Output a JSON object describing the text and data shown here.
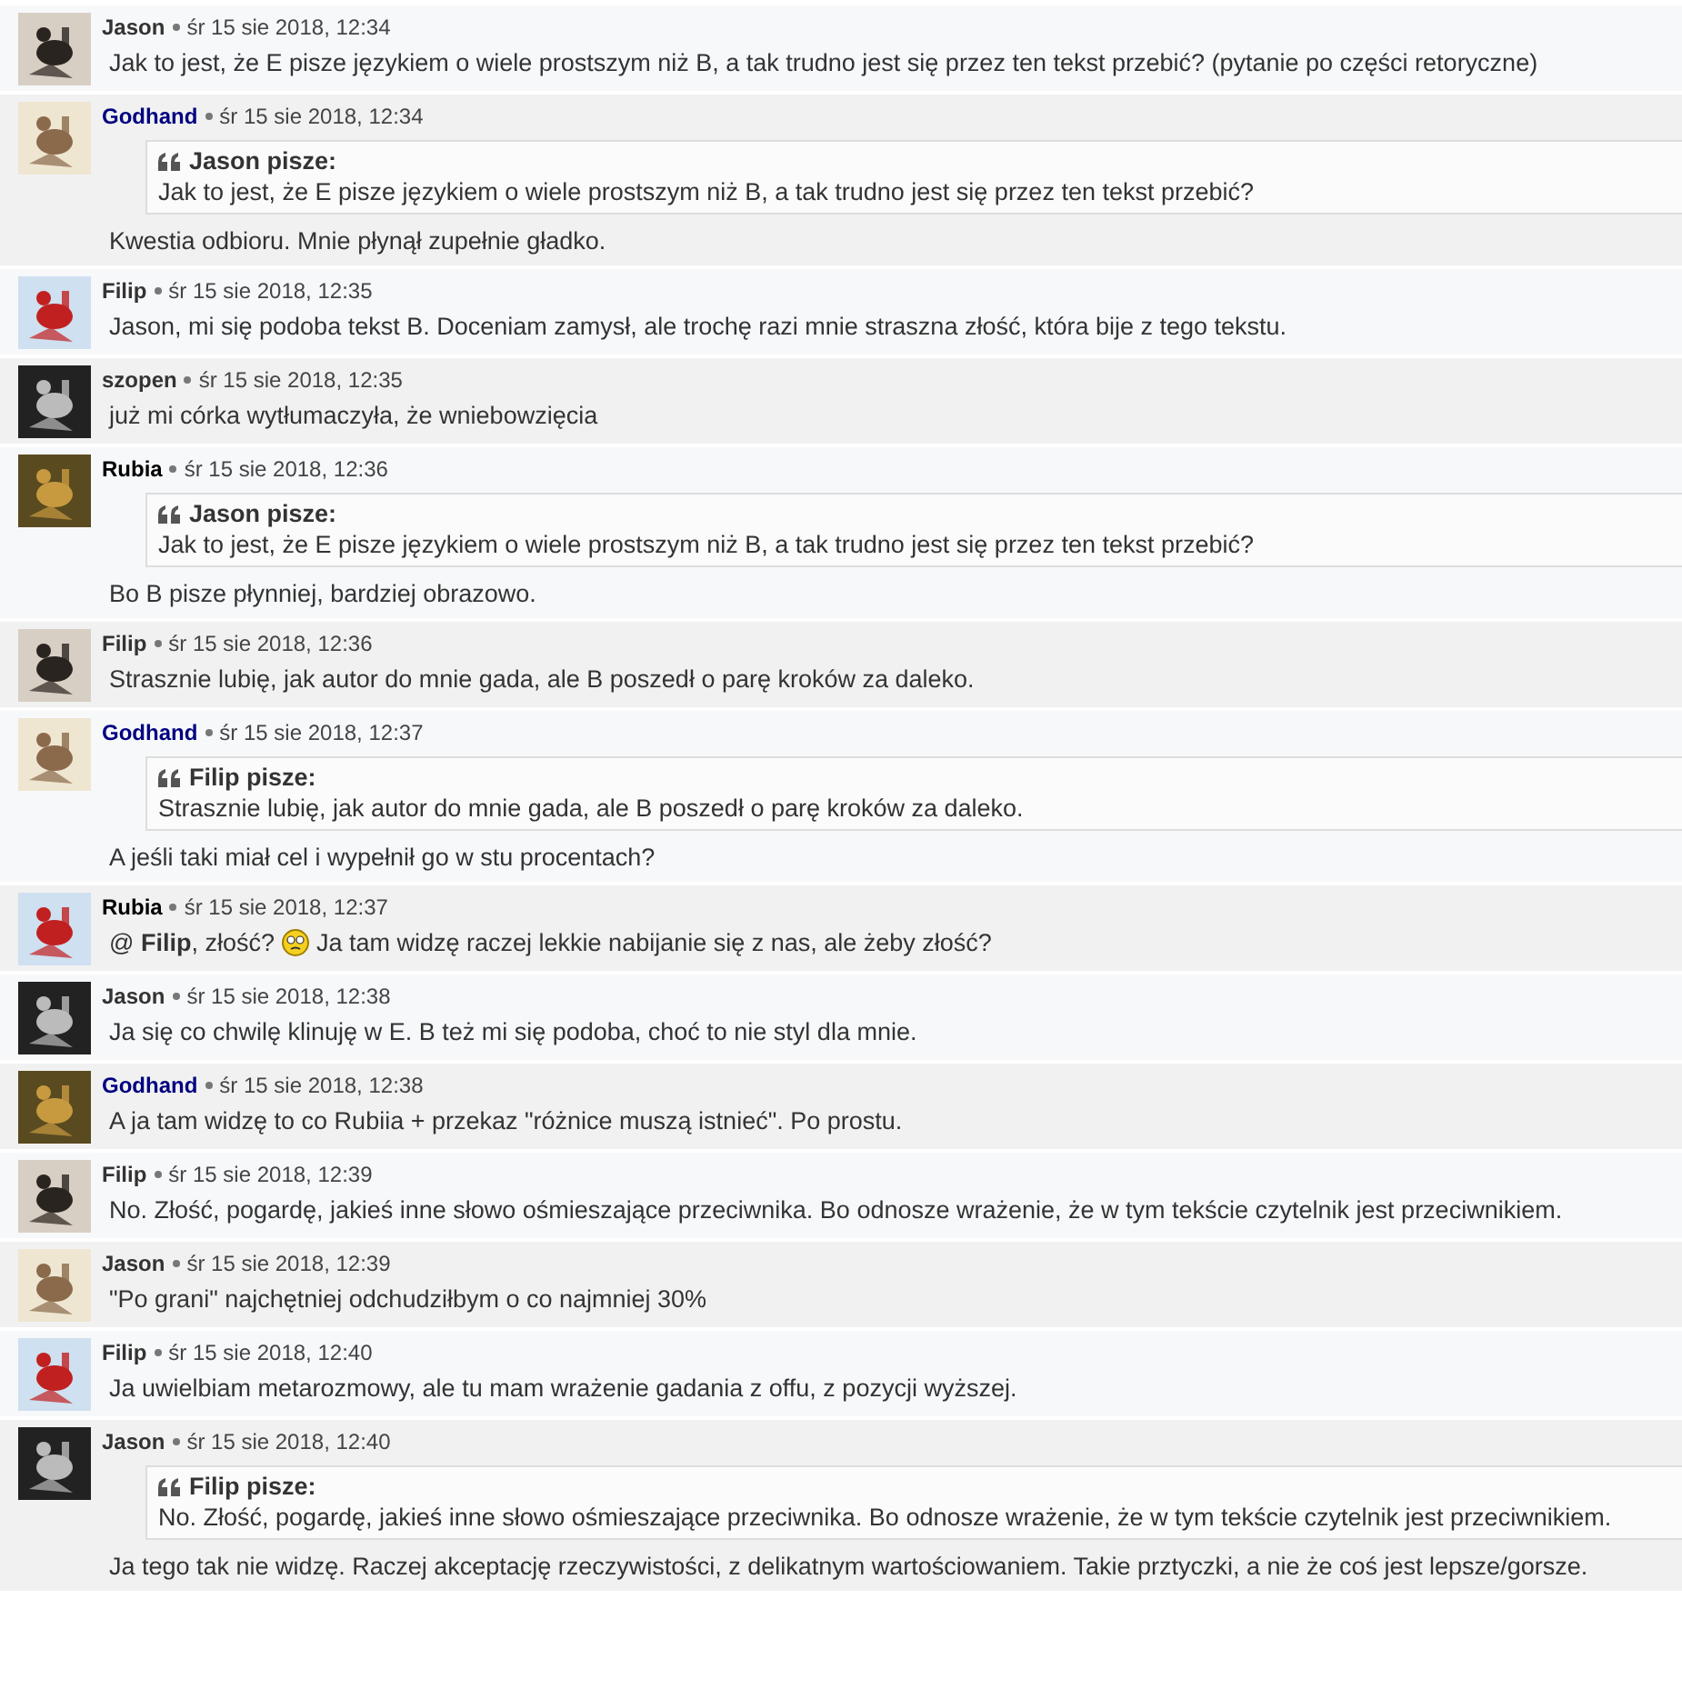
{
  "posts": [
    {
      "author": "Jason",
      "color": "#333333",
      "date": "śr 15 sie 2018, 12:34",
      "body": "Jak to jest, że E pisze językiem o wiele prostszym niż B, a tak trudno jest się przez ten tekst przebić? (pytanie po części retoryczne)"
    },
    {
      "author": "Godhand",
      "color": "#000080",
      "date": "śr 15 sie 2018, 12:34",
      "quote": {
        "label": "Jason pisze:",
        "text": "Jak to jest, że E pisze językiem o wiele prostszym niż B, a tak trudno jest się przez ten tekst przebić?"
      },
      "body": "Kwestia odbioru. Mnie płynął zupełnie gładko."
    },
    {
      "author": "Filip",
      "color": "#333333",
      "date": "śr 15 sie 2018, 12:35",
      "body": "Jason, mi się podoba tekst B. Doceniam zamysł, ale trochę razi mnie straszna złość, która bije z tego tekstu."
    },
    {
      "author": "szopen",
      "color": "#333333",
      "date": "śr 15 sie 2018, 12:35",
      "body": "już mi córka wytłumaczyła, że wniebowzięcia"
    },
    {
      "author": "Rubia",
      "color": "#000000",
      "date": "śr 15 sie 2018, 12:36",
      "quote": {
        "label": "Jason pisze:",
        "text": "Jak to jest, że E pisze językiem o wiele prostszym niż B, a tak trudno jest się przez ten tekst przebić?"
      },
      "body": "Bo B pisze płynniej, bardziej obrazowo."
    },
    {
      "author": "Filip",
      "color": "#333333",
      "date": "śr 15 sie 2018, 12:36",
      "body": "Strasznie lubię, jak autor do mnie gada, ale B poszedł o parę kroków za daleko."
    },
    {
      "author": "Godhand",
      "color": "#000080",
      "date": "śr 15 sie 2018, 12:37",
      "quote": {
        "label": "Filip pisze:",
        "text": "Strasznie lubię, jak autor do mnie gada, ale B poszedł o parę kroków za daleko."
      },
      "body": "A jeśli taki miał cel i wypełnił go w stu procentach?"
    },
    {
      "author": "Rubia",
      "color": "#000000",
      "date": "śr 15 sie 2018, 12:37",
      "body": [
        {
          "kind": "text",
          "text": "@ **Filip**, złość?"
        },
        {
          "kind": "smiley"
        },
        {
          "kind": "text",
          "text": "Ja tam widzę raczej lekkie nabijanie się z nas, ale żeby złość?"
        }
      ]
    },
    {
      "author": "Jason",
      "color": "#333333",
      "date": "śr 15 sie 2018, 12:38",
      "body": "Ja się co chwilę klinuję w E. B też mi się podoba, choć to nie styl dla mnie."
    },
    {
      "author": "Godhand",
      "color": "#000080",
      "date": "śr 15 sie 2018, 12:38",
      "body": "A ja tam widzę to co Rubiia + przekaz \"różnice muszą istnieć\". Po prostu."
    },
    {
      "author": "Filip",
      "color": "#333333",
      "date": "śr 15 sie 2018, 12:39",
      "body": "No. Złość, pogardę, jakieś inne słowo ośmieszające przeciwnika. Bo odnosze wrażenie, że w tym tekście czytelnik jest przeciwnikiem."
    },
    {
      "author": "Jason",
      "color": "#333333",
      "date": "śr 15 sie 2018, 12:39",
      "body": "\"Po grani\" najchętniej odchudziłbym o co najmniej 30%"
    },
    {
      "author": "Filip",
      "color": "#333333",
      "date": "śr 15 sie 2018, 12:40",
      "body": "Ja uwielbiam metarozmowy, ale tu mam wrażenie gadania z offu, z pozycji wyższej."
    },
    {
      "author": "Jason",
      "color": "#333333",
      "date": "śr 15 sie 2018, 12:40",
      "quote": {
        "label": "Filip pisze:",
        "text": "No. Złość, pogardę, jakieś inne słowo ośmieszające przeciwnika. Bo odnosze wrażenie, że w tym tekście czytelnik jest przeciwnikiem."
      },
      "body": "Ja tego tak nie widzę. Raczej akceptację rzeczywistości, z delikatnym wartościowaniem. Takie prztyczki, a nie że coś jest lepsze/gorsze."
    }
  ]
}
